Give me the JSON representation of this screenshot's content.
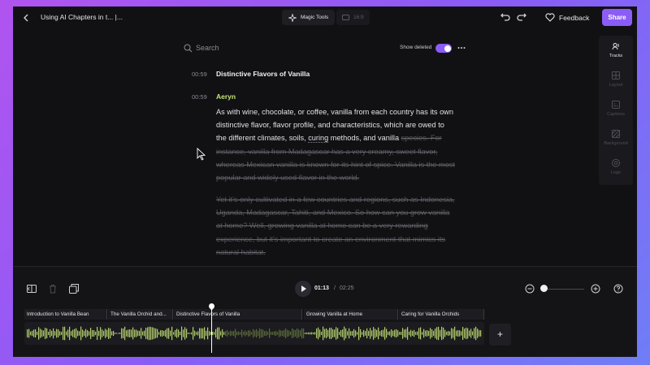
{
  "header": {
    "title": "Using AI Chapters in t... |...",
    "magic_tools": "Magic Tools",
    "aspect_ratio": "16:9",
    "feedback": "Feedback",
    "share": "Share"
  },
  "search": {
    "placeholder": "Search",
    "show_deleted_label": "Show deleted",
    "show_deleted_on": true
  },
  "transcript": {
    "chapter": {
      "time": "00:59",
      "title": "Distinctive Flavors of Vanilla"
    },
    "speaker": {
      "time": "00:59",
      "name": "Aeryn"
    },
    "para1_kept_a": "As with wine, chocolate, or coffee, vanilla from each country has its own distinctive flavor, flavor profile, and characteristics, which are owed to the different climates, soils, ",
    "para1_curing": "curing",
    "para1_kept_b": " methods, and vanilla",
    "para1_deleted": "species. For instance, vanilla from Madagascar has a very creamy, sweet flavor, whereas Mexican vanilla is known for its hint of spice. Vanilla is the most popular and widely used flavor in the world.",
    "para2_deleted": "Yet it's only cultivated in a few countries and regions, such as Indonesia, Uganda, Madagascar, Tahiti, and Mexico. So how can you grow vanilla at home? Well, growing vanilla at home can be a very rewarding experience, but it's important to create an environment that mimics its natural habitat."
  },
  "side_panel": {
    "items": [
      {
        "label": "Tracks",
        "icon": "tracks-icon"
      },
      {
        "label": "Layout",
        "icon": "layout-icon"
      },
      {
        "label": "Captions",
        "icon": "captions-icon"
      },
      {
        "label": "Background",
        "icon": "background-icon"
      },
      {
        "label": "Logo",
        "icon": "logo-icon"
      }
    ]
  },
  "timeline": {
    "current_time": "01:13",
    "separator": "/",
    "total_time": "02:25",
    "chapters": [
      "Introduction to Vanilla Bean",
      "The Vanilla Orchid and...",
      "Distinctive Flavors of Vanilla",
      "Growing Vanilla at Home",
      "Caring for Vanilla Orchids"
    ],
    "add_label": "+"
  },
  "colors": {
    "accent": "#8b5cf6",
    "speaker": "#c5e47a",
    "waveform": "#b3cf6c"
  }
}
